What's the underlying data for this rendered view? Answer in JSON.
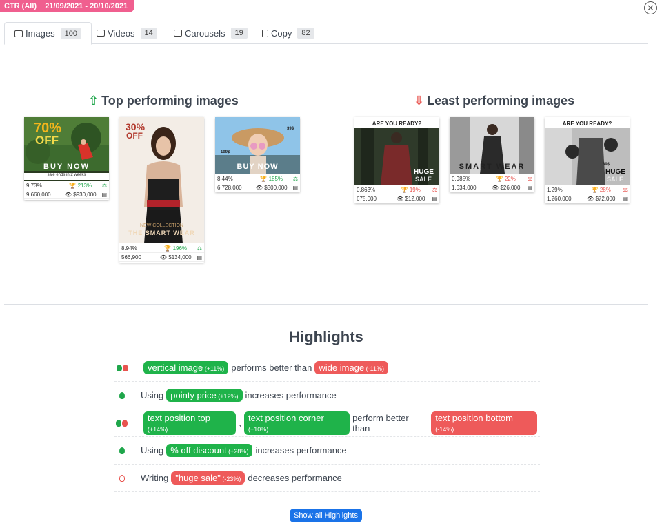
{
  "header": {
    "badge": "CTR (All)    21/09/2021 - 20/10/2021"
  },
  "tabs": [
    {
      "label": "Images",
      "count": "100"
    },
    {
      "label": "Videos",
      "count": "14"
    },
    {
      "label": "Carousels",
      "count": "19"
    },
    {
      "label": "Copy",
      "count": "82"
    }
  ],
  "top": {
    "title": "Top performing images",
    "cards": [
      {
        "ctr": "9.73%",
        "lift": "213%",
        "impr": "9,660,000",
        "spend": "$930,000",
        "headline": "70%",
        "sub": "OFF",
        "tagline": "sale ends in 2 weeks",
        "cta": "BUY NOW"
      },
      {
        "ctr": "8.94%",
        "lift": "196%",
        "impr": "566,900",
        "spend": "$134,000",
        "headline": "30%",
        "sub": "OFF",
        "tagline": "NEW COLLECTION",
        "cta": "THE SMART WEAR"
      },
      {
        "ctr": "8.44%",
        "lift": "185%",
        "impr": "6,728,000",
        "spend": "$300,000",
        "price1": "199$",
        "price2": "39$",
        "cta": "BUY NOW"
      }
    ]
  },
  "least": {
    "title": "Least performing images",
    "cards": [
      {
        "ctr": "0.863%",
        "lift": "19%",
        "impr": "675,000",
        "spend": "$12,000",
        "banner": "ARE YOU READY?",
        "cta": "HUGE",
        "cta2": "SALE"
      },
      {
        "ctr": "0.985%",
        "lift": "22%",
        "impr": "1,634,000",
        "spend": "$26,000",
        "cta": "SMART WEAR"
      },
      {
        "ctr": "1.29%",
        "lift": "28%",
        "impr": "1,260,000",
        "spend": "$72,000",
        "banner": "ARE YOU READY?",
        "price1": "39$",
        "cta": "HUGE",
        "cta2": "SALE"
      }
    ]
  },
  "highlights": {
    "title": "Highlights",
    "rows": [
      {
        "parts": [
          {
            "t": "pill-g",
            "text": "vertical image",
            "delta": "(+11%)"
          },
          {
            "t": "text",
            "text": "performs better than"
          },
          {
            "t": "pill-r",
            "text": "wide image",
            "delta": "(-11%)"
          }
        ]
      },
      {
        "parts": [
          {
            "t": "text",
            "text": "Using"
          },
          {
            "t": "pill-g",
            "text": "pointy price",
            "delta": "(+12%)"
          },
          {
            "t": "text",
            "text": "increases performance"
          }
        ]
      },
      {
        "parts": [
          {
            "t": "pill-g",
            "text": "text position top",
            "delta": "(+14%)"
          },
          {
            "t": "text",
            "text": ","
          },
          {
            "t": "pill-g",
            "text": "text position corner",
            "delta": "(+10%)"
          },
          {
            "t": "text",
            "text": "perform better than"
          },
          {
            "t": "pill-r",
            "text": "text position bottom",
            "delta": "(-14%)"
          }
        ]
      },
      {
        "parts": [
          {
            "t": "text",
            "text": "Using"
          },
          {
            "t": "pill-g",
            "text": "% off discount",
            "delta": "(+28%)"
          },
          {
            "t": "text",
            "text": "increases performance"
          }
        ]
      },
      {
        "parts": [
          {
            "t": "text",
            "text": "Writing"
          },
          {
            "t": "pill-r",
            "text": "\"huge sale\"",
            "delta": "(-23%)"
          },
          {
            "t": "text",
            "text": "decreases performance"
          }
        ]
      }
    ],
    "button": "Show all Highlights"
  },
  "colors": {
    "accent": "#1a73e8",
    "badge": "#f05f8f",
    "positive": "#1fb34a",
    "negative": "#ee5a5a"
  }
}
